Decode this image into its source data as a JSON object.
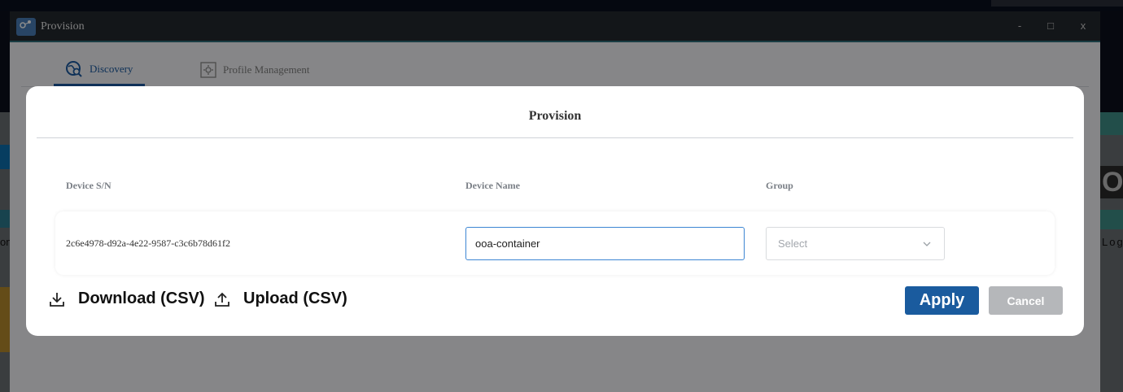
{
  "window": {
    "title": "Provision",
    "controls": {
      "minimize": "-",
      "maximize": "□",
      "close": "x"
    }
  },
  "tabs": [
    {
      "label": "Discovery",
      "icon": "globe-search-icon",
      "active": true
    },
    {
      "label": "Profile Management",
      "icon": "gear-icon",
      "active": false
    }
  ],
  "modal": {
    "title": "Provision",
    "columns": {
      "serial": "Device S/N",
      "name": "Device Name",
      "group": "Group"
    },
    "row": {
      "serial": "2c6e4978-d92a-4e22-9587-c3c6b78d61f2",
      "device_name": "ooa-container",
      "group_placeholder": "Select"
    },
    "actions": {
      "download": "Download (CSV)",
      "upload": "Upload (CSV)",
      "apply": "Apply",
      "cancel": "Cancel"
    }
  },
  "background": {
    "left_fragment": "on",
    "right_fragment_large": "O",
    "right_fragment_small": "Log"
  },
  "colors": {
    "accent": "#1a5b9e",
    "input_focus": "#3d86d3",
    "cancel_bg": "#b5b7ba",
    "titlebar": "#24282e"
  }
}
